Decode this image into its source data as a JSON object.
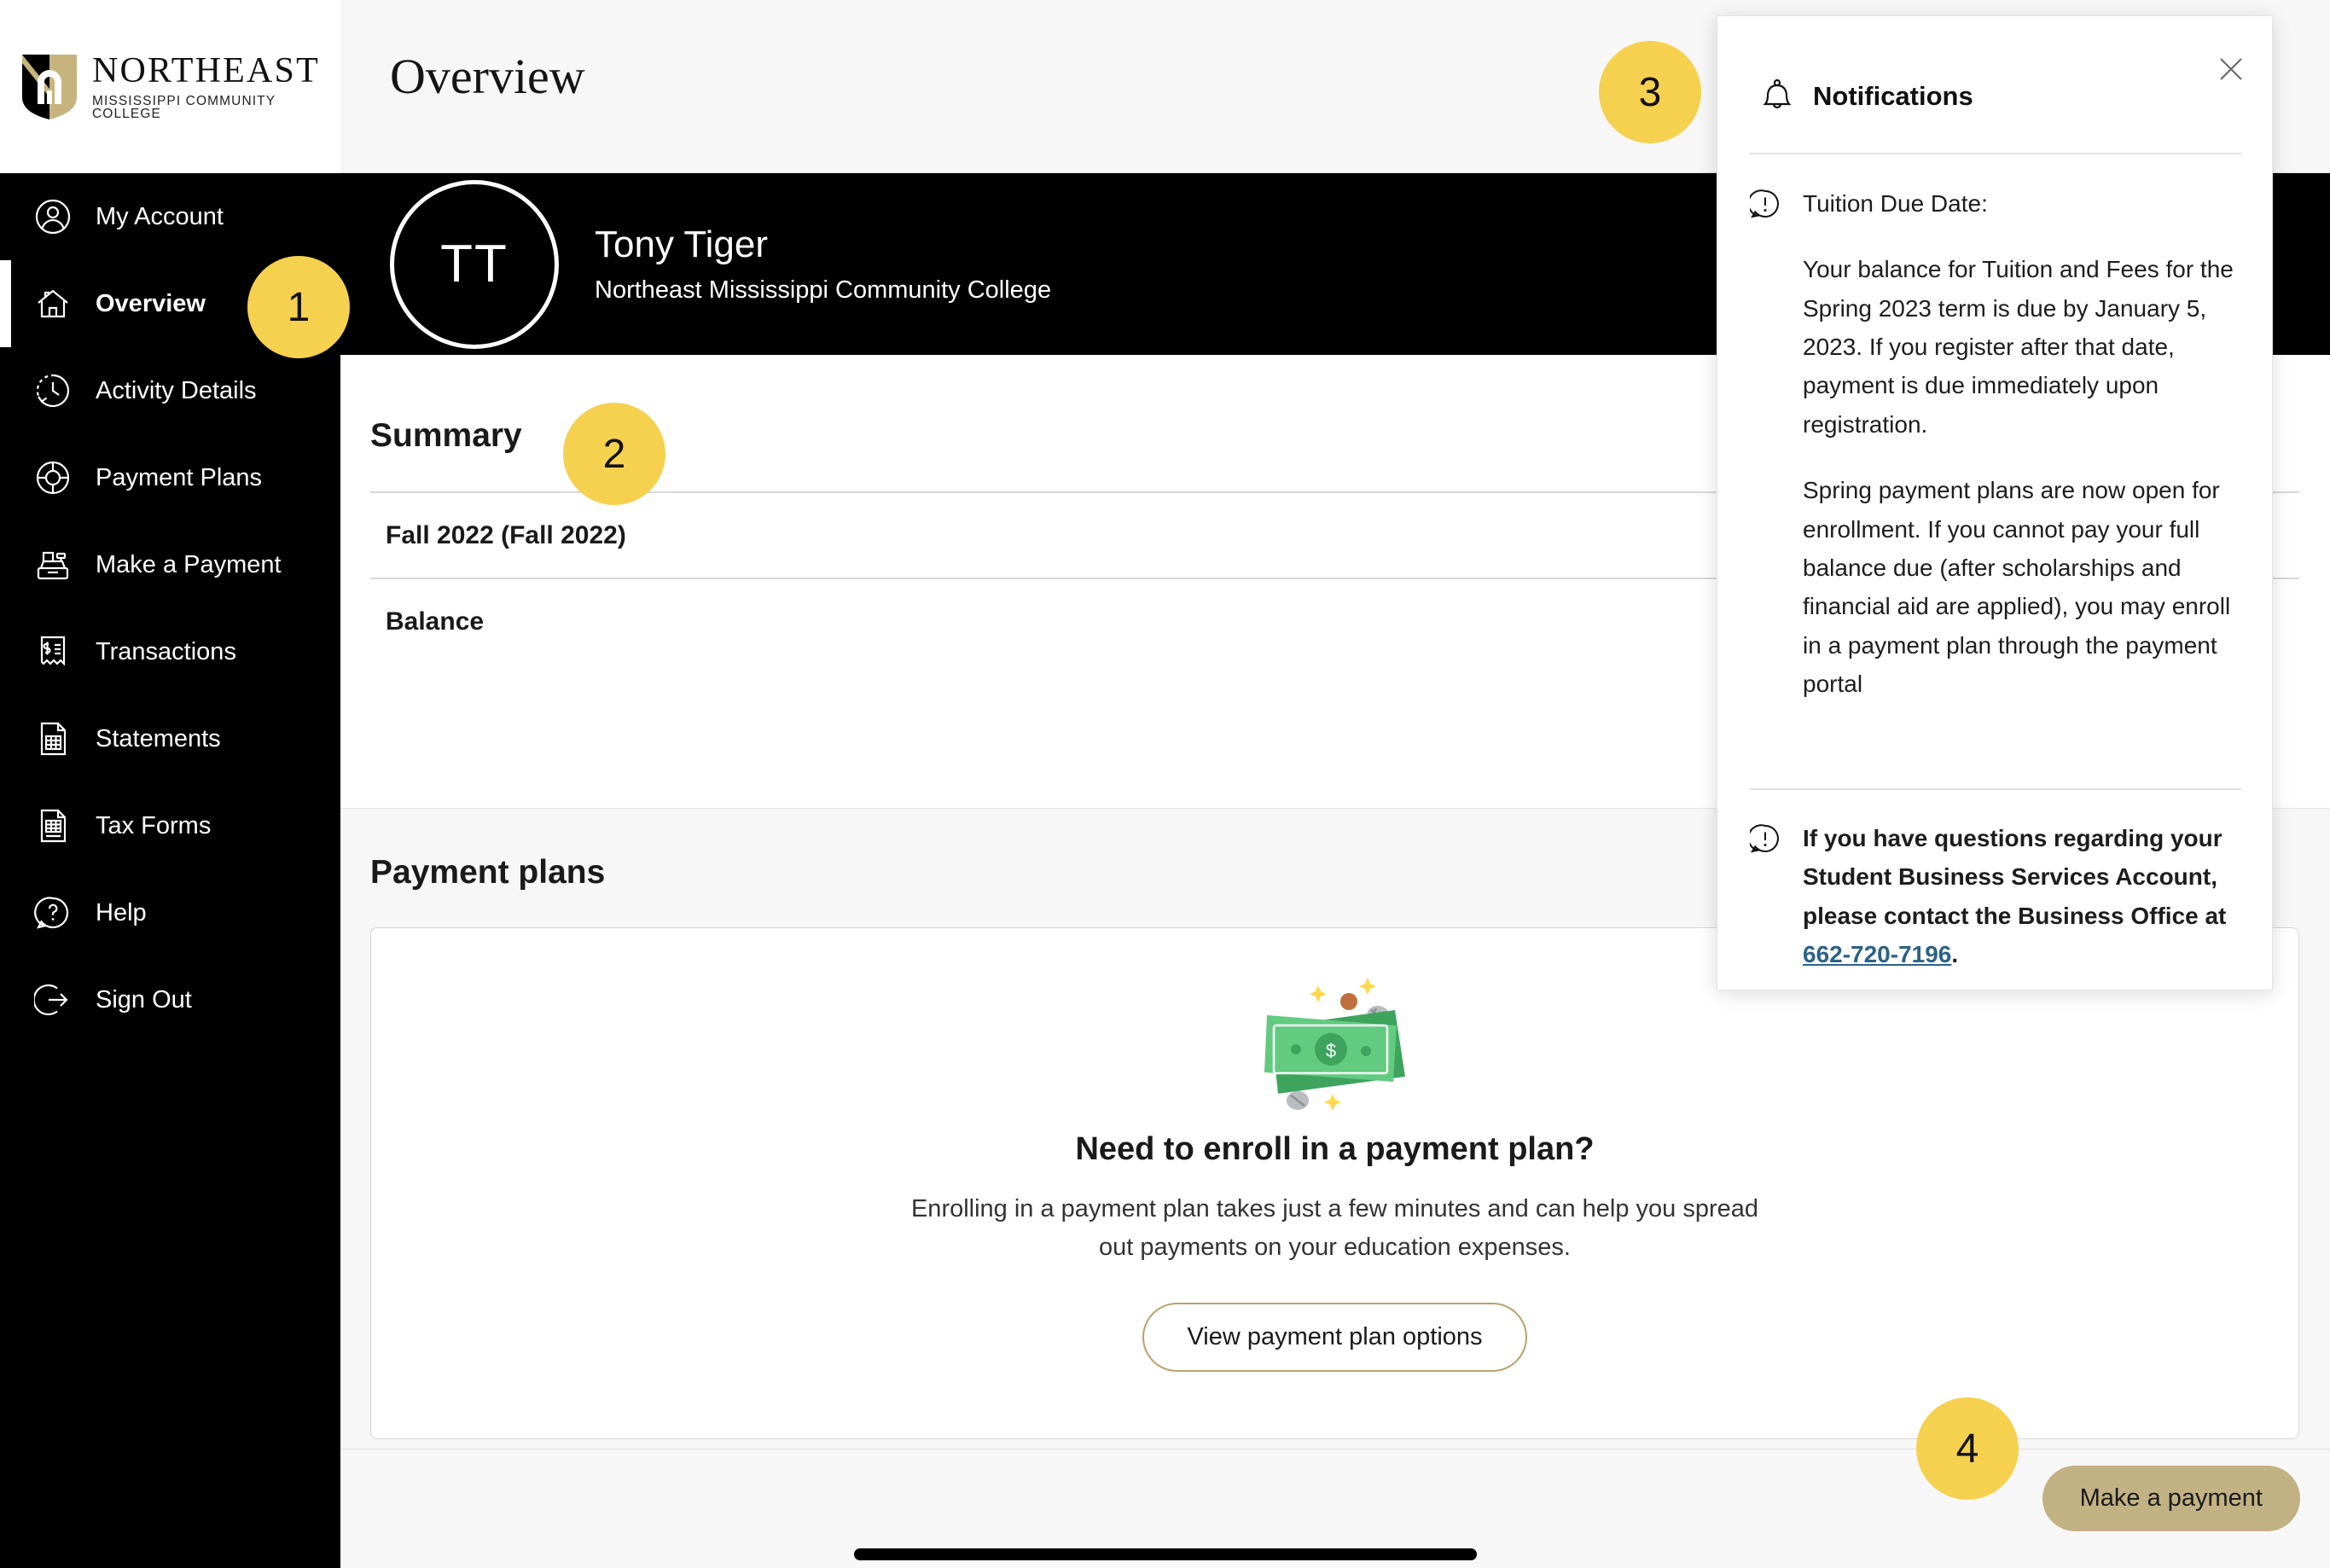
{
  "brand": {
    "name": "NORTHEAST",
    "subtitle": "MISSISSIPPI COMMUNITY COLLEGE",
    "logo_icon": "northeast-shield-logo"
  },
  "sidebar": {
    "items": [
      {
        "label": "My Account",
        "icon": "user-circle-icon",
        "active": false
      },
      {
        "label": "Overview",
        "icon": "home-icon",
        "active": true
      },
      {
        "label": "Activity Details",
        "icon": "clock-history-icon",
        "active": false
      },
      {
        "label": "Payment Plans",
        "icon": "donut-chart-icon",
        "active": false
      },
      {
        "label": "Make a Payment",
        "icon": "cash-register-icon",
        "active": false
      },
      {
        "label": "Transactions",
        "icon": "receipt-dollar-icon",
        "active": false
      },
      {
        "label": "Statements",
        "icon": "document-grid-icon",
        "active": false
      },
      {
        "label": "Tax Forms",
        "icon": "tax-document-icon",
        "active": false
      },
      {
        "label": "Help",
        "icon": "question-bubble-icon",
        "active": false
      },
      {
        "label": "Sign Out",
        "icon": "sign-out-icon",
        "active": false
      }
    ]
  },
  "header": {
    "title": "Overview"
  },
  "user": {
    "initials": "TT",
    "name": "Tony Tiger",
    "organization": "Northeast Mississippi Community College"
  },
  "summary": {
    "title": "Summary",
    "rows": [
      {
        "label": "Fall 2022 (Fall 2022)",
        "value": ""
      },
      {
        "label": "Balance",
        "value": ""
      }
    ]
  },
  "payment_plans": {
    "title": "Payment plans",
    "illustration_icon": "money-bills-coins-illustration",
    "empty_heading": "Need to enroll in a payment plan?",
    "empty_body": "Enrolling in a payment plan takes just a few minutes and can help you spread out payments on your education expenses.",
    "cta_label": "View payment plan options"
  },
  "footer": {
    "make_payment_label": "Make a payment"
  },
  "notifications": {
    "title": "Notifications",
    "bell_icon": "bell-icon",
    "close_icon": "close-icon",
    "alert_icon": "alert-circle-icon",
    "items": [
      {
        "paragraphs": [
          "Tuition Due Date:",
          "Your balance for Tuition and Fees for the Spring 2023 term is due by January 5, 2023. If you register after that date, payment is due immediately upon registration.",
          "Spring payment plans are now open for enrollment. If you cannot pay your full balance due (after scholarships and financial aid are applied), you may enroll in a payment plan through the payment portal"
        ],
        "bold": false
      }
    ],
    "contact_note": {
      "text_before": "If you have questions regarding your Student Business Services Account, please contact the Business Office at ",
      "phone": "662-720-7196",
      "text_after": "."
    }
  },
  "callouts": [
    {
      "number": "1",
      "target": "sidebar-overview"
    },
    {
      "number": "2",
      "target": "summary-section"
    },
    {
      "number": "3",
      "target": "notifications-bell"
    },
    {
      "number": "4",
      "target": "make-a-payment-button"
    }
  ],
  "occluded": {
    "ghost_link": "s",
    "accent_color": "#b8a16a"
  },
  "colors": {
    "callout": "#F5D14F",
    "gold_button": "#c2b183",
    "gold_outline": "#b8a16a",
    "link": "#2d6286",
    "sidebar_bg": "#000000",
    "page_bg": "#f7f7f7"
  }
}
